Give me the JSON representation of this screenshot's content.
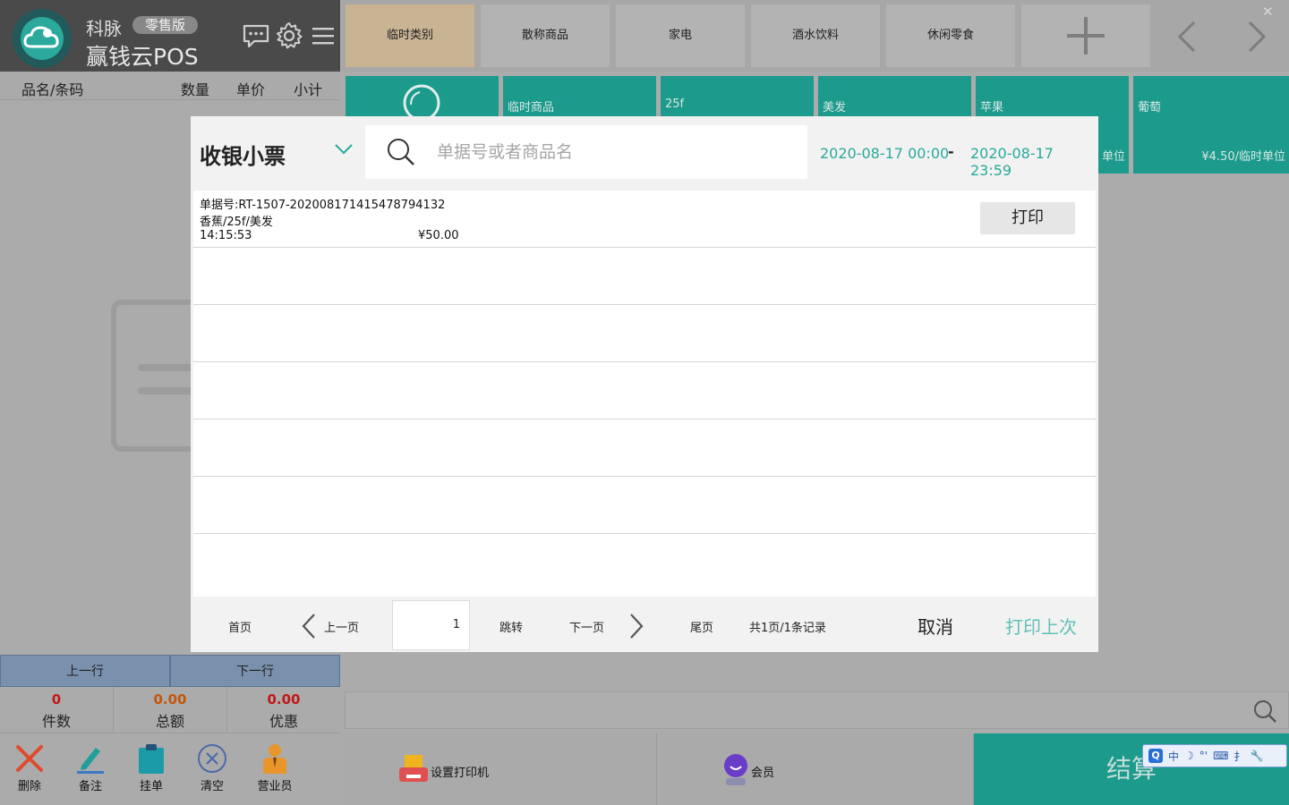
{
  "brand": {
    "company": "科脉",
    "edition": "零售版",
    "product": "赢钱云POS"
  },
  "header_icons": [
    "chat-icon",
    "gear-icon",
    "menu-icon"
  ],
  "cart": {
    "columns": [
      "品名/条码",
      "数量",
      "单价",
      "小计"
    ]
  },
  "row_nav": {
    "prev": "上一行",
    "next": "下一行"
  },
  "totals": [
    {
      "value": "0",
      "label": "件数",
      "color": "#c01818"
    },
    {
      "value": "0.00",
      "label": "总额",
      "color": "#c0560c"
    },
    {
      "value": "0.00",
      "label": "优惠",
      "color": "#c01818"
    }
  ],
  "tools": [
    {
      "label": "删除",
      "icon": "delete-x-icon",
      "color": "#e04a2c"
    },
    {
      "label": "备注",
      "icon": "pen-icon",
      "color": "#1f9e9a"
    },
    {
      "label": "挂单",
      "icon": "clipboard-icon",
      "color": "#1b9aa8"
    },
    {
      "label": "清空",
      "icon": "clear-circle-icon",
      "color": "#4a6aa8"
    },
    {
      "label": "营业员",
      "icon": "salesperson-icon",
      "color": "#e8962a"
    }
  ],
  "categories": [
    {
      "label": "临时类别",
      "active": true
    },
    {
      "label": "散称商品",
      "active": false
    },
    {
      "label": "家电",
      "active": false
    },
    {
      "label": "酒水饮料",
      "active": false
    },
    {
      "label": "休闲零食",
      "active": false
    }
  ],
  "category_controls": [
    "add-category-icon",
    "chevron-left-icon",
    "chevron-right-icon",
    "close-icon"
  ],
  "products": [
    {
      "name": "",
      "price": "",
      "icon": "loading-icon"
    },
    {
      "name": "临时商品",
      "price": ""
    },
    {
      "name": "25f",
      "price": ""
    },
    {
      "name": "美发",
      "price": ""
    },
    {
      "name": "苹果",
      "price": "单位"
    },
    {
      "name": "葡萄",
      "price": "¥4.50/临时单位"
    }
  ],
  "bottom": {
    "printer": "设置打印机",
    "member": "会员",
    "settle": "结算"
  },
  "ime": {
    "logo": "Q",
    "items": [
      "中",
      "☽",
      "°'",
      "⌨",
      "扌",
      "🔧"
    ]
  },
  "modal": {
    "title": "收银小票",
    "search_placeholder": "单据号或者商品名",
    "date_start": "2020-08-17 00:00",
    "date_sep": "-",
    "date_end": "2020-08-17 23:59",
    "receipts": [
      {
        "number": "单据号:RT-1507-20200817141547879413​2",
        "items": "香蕉/25f/美发",
        "time": "14:15:53",
        "amount": "¥50.00",
        "print_label": "打印"
      }
    ],
    "pager": {
      "first": "首页",
      "prev": "上一页",
      "page": "1",
      "jump": "跳转",
      "next": "下一页",
      "last": "尾页",
      "summary": "共1页/1条记录"
    },
    "cancel": "取消",
    "print_last": "打印上次"
  }
}
